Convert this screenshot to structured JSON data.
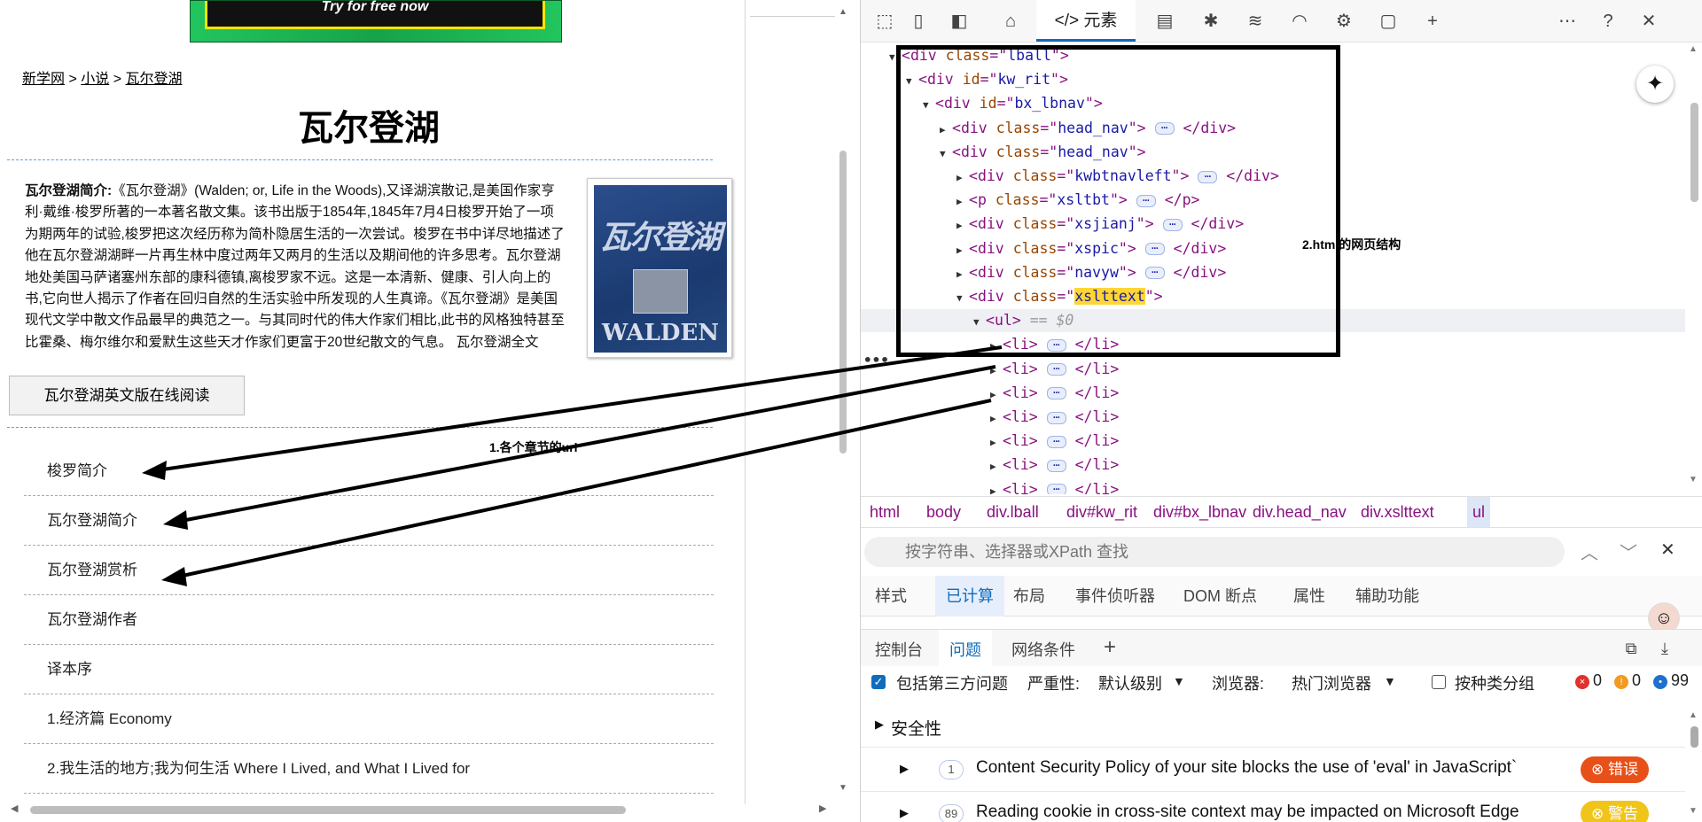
{
  "left_page": {
    "ad_text": "Try for free now",
    "breadcrumb": {
      "home": "新学网",
      "sep1": " > ",
      "category": "小说",
      "sep2": " > ",
      "current": "瓦尔登湖"
    },
    "title": "瓦尔登湖",
    "intro_label": "瓦尔登湖简介:",
    "intro_text": "《瓦尔登湖》(Walden; or, Life in the Woods),又译湖滨散记,是美国作家亨利·戴维·梭罗所著的一本著名散文集。该书出版于1854年,1845年7月4日梭罗开始了一项为期两年的试验,梭罗把这次经历称为简朴隐居生活的一次尝试。梭罗在书中详尽地描述了他在瓦尔登湖湖畔一片再生林中度过两年又两月的生活以及期间他的许多思考。瓦尔登湖地处美国马萨诸塞州东部的康科德镇,离梭罗家不远。这是一本清新、健康、引人向上的书,它向世人揭示了作者在回归自然的生活实验中所发现的人生真谛。《瓦尔登湖》是美国现代文学中散文作品最早的典范之一。与其同时代的伟大作家们相比,此书的风格独特甚至比霍桑、梅尔维尔和爱默生这些天才作家们更富于20世纪散文的气息。 瓦尔登湖全文",
    "cover_title": "瓦尔登湖",
    "cover_subtitle": "WALDEN",
    "english_button": "瓦尔登湖英文版在线阅读",
    "annotation_chapters": "1.各个章节的url",
    "chapters": [
      "梭罗简介",
      "瓦尔登湖简介",
      "瓦尔登湖赏析",
      "瓦尔登湖作者",
      "译本序",
      "1.经济篇 Economy",
      "2.我生活的地方;我为何生活 Where I Lived, and What I Lived for"
    ]
  },
  "devtools": {
    "elements_tab": "元素",
    "annotation_dom": "2.html的网页结构",
    "dom_lines": [
      {
        "indent": 0,
        "open": "down",
        "tag": "div",
        "attr": "class",
        "value": "lball",
        "ellipsis": false,
        "close": false
      },
      {
        "indent": 1,
        "open": "down",
        "tag": "div",
        "attr": "id",
        "value": "kw_rit",
        "ellipsis": false,
        "close": false
      },
      {
        "indent": 2,
        "open": "down",
        "tag": "div",
        "attr": "id",
        "value": "bx_lbnav",
        "ellipsis": false,
        "close": false
      },
      {
        "indent": 3,
        "open": "right",
        "tag": "div",
        "attr": "class",
        "value": "head_nav",
        "ellipsis": true,
        "close": true
      },
      {
        "indent": 3,
        "open": "down",
        "tag": "div",
        "attr": "class",
        "value": "head_nav",
        "ellipsis": false,
        "close": false
      },
      {
        "indent": 4,
        "open": "right",
        "tag": "div",
        "attr": "class",
        "value": "kwbtnavleft",
        "ellipsis": true,
        "close": true
      },
      {
        "indent": 4,
        "open": "right",
        "tag": "p",
        "attr": "class",
        "value": "xsltbt",
        "ellipsis": true,
        "close": true
      },
      {
        "indent": 4,
        "open": "right",
        "tag": "div",
        "attr": "class",
        "value": "xsjianj",
        "ellipsis": true,
        "close": true
      },
      {
        "indent": 4,
        "open": "right",
        "tag": "div",
        "attr": "class",
        "value": "xspic",
        "ellipsis": true,
        "close": true
      },
      {
        "indent": 4,
        "open": "right",
        "tag": "div",
        "attr": "class",
        "value": "navyw",
        "ellipsis": true,
        "close": true
      },
      {
        "indent": 4,
        "open": "down",
        "tag": "div",
        "attr": "class",
        "value": "xslttext",
        "ellipsis": false,
        "close": false,
        "highlight": true
      }
    ],
    "selected_line": {
      "tag": "ul",
      "suffix": "== $0"
    },
    "li_count": 7,
    "breadcrumb": [
      "html",
      "body",
      "div.lball",
      "div#kw_rit",
      "div#bx_lbnav",
      "div.head_nav",
      "div.xslttext",
      "ul"
    ],
    "search_placeholder": "按字符串、选择器或XPath 查找",
    "sub_tabs": [
      "样式",
      "已计算",
      "布局",
      "事件侦听器",
      "DOM 断点",
      "属性",
      "辅助功能"
    ],
    "sub_tab_active": "已计算",
    "drawer_tabs": [
      "控制台",
      "问题",
      "网络条件"
    ],
    "drawer_active": "问题",
    "issues_filter": {
      "third_party": "包括第三方问题",
      "severity_label": "严重性:",
      "severity_value": "默认级别",
      "browser_label": "浏览器:",
      "browser_value": "热门浏览器",
      "group_label": "按种类分组",
      "errors": "0",
      "warnings": "0",
      "infos": "99"
    },
    "section_security": "安全性",
    "issues": [
      {
        "count": "1",
        "text": "Content Security Policy of your site blocks the use of 'eval' in JavaScript`",
        "badge": "错误",
        "badge_color": "#e8501a"
      },
      {
        "count": "89",
        "text": "Reading cookie in cross-site context may be impacted on Microsoft Edge",
        "badge": "警告",
        "badge_color": "#f0c419"
      }
    ]
  }
}
